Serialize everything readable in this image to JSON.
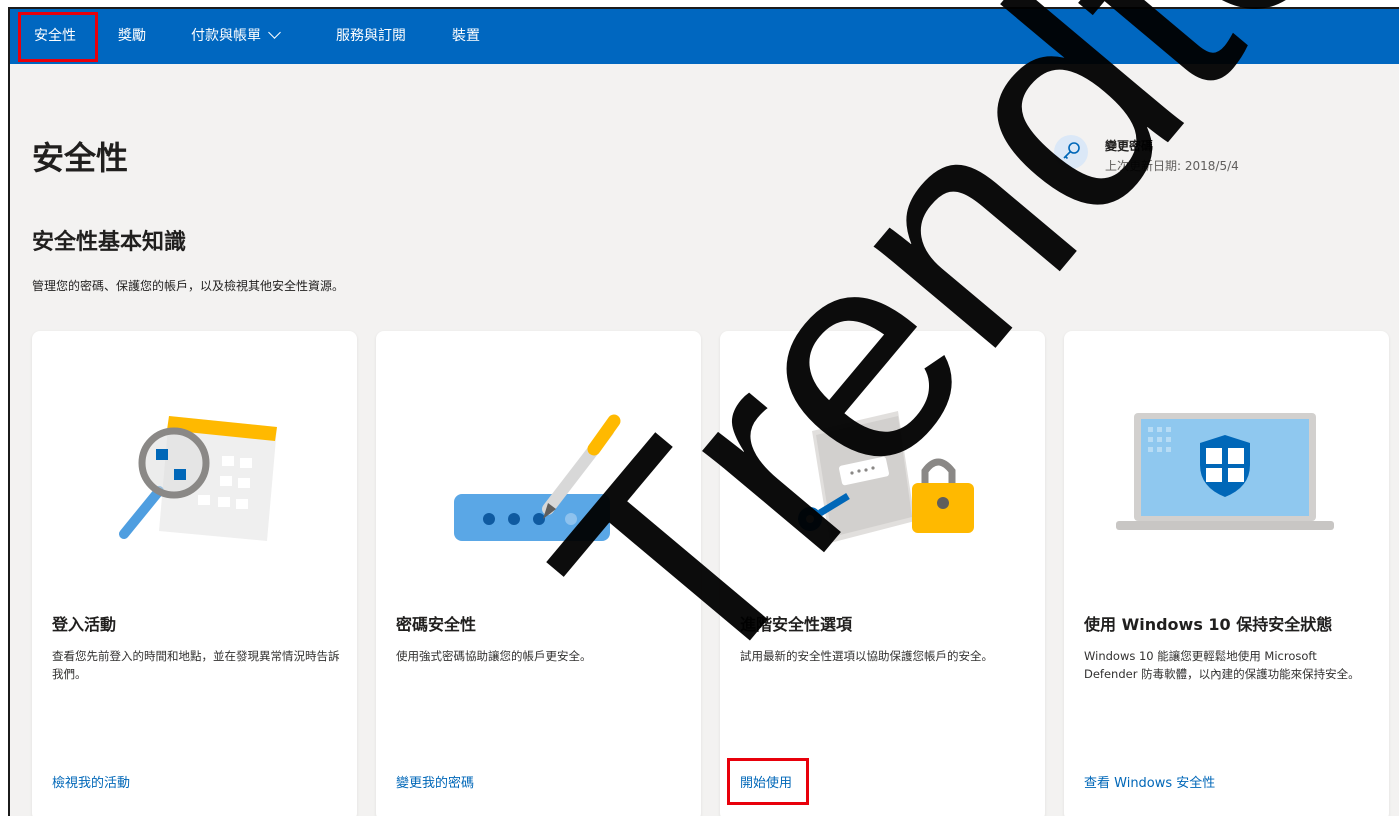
{
  "nav": {
    "items": [
      {
        "label": "安全性"
      },
      {
        "label": "獎勵"
      },
      {
        "label": "付款與帳單"
      },
      {
        "label": "服務與訂閱"
      },
      {
        "label": "裝置"
      }
    ]
  },
  "page": {
    "title": "安全性",
    "section_title": "安全性基本知識",
    "section_desc": "管理您的密碼、保護您的帳戶，以及檢視其他安全性資源。"
  },
  "password_change": {
    "title": "變更密碼",
    "date": "上次更新日期: 2018/5/4",
    "icon": "key-icon"
  },
  "cards": [
    {
      "title": "登入活動",
      "desc": "查看您先前登入的時間和地點，並在發現異常情況時告訴我們。",
      "link": "檢視我的活動",
      "icon": "magnifier-calendar-illustration"
    },
    {
      "title": "密碼安全性",
      "desc": "使用強式密碼協助讓您的帳戶更安全。",
      "link": "變更我的密碼",
      "icon": "password-pen-illustration"
    },
    {
      "title": "進階安全性選項",
      "desc": "試用最新的安全性選項以協助保護您帳戶的安全。",
      "link": "開始使用",
      "icon": "lock-key-illustration"
    },
    {
      "title": "使用 Windows 10 保持安全狀態",
      "desc": "Windows 10 能讓您更輕鬆地使用 Microsoft Defender 防毒軟體，以內建的保護功能來保持安全。",
      "link": "查看 Windows 安全性",
      "icon": "laptop-shield-illustration"
    }
  ],
  "watermark": {
    "text": "Trendtek"
  },
  "colors": {
    "nav_bg": "#0067c0",
    "link": "#0067b8",
    "highlight": "#e8000b",
    "page_bg": "#f3f2f1"
  }
}
